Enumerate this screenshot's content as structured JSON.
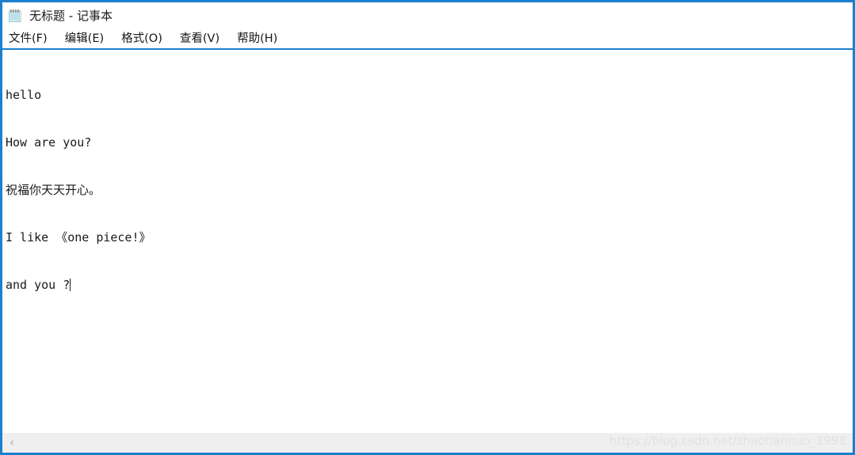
{
  "window": {
    "border_color": "#1b80ce",
    "background": "#ffffff"
  },
  "titlebar": {
    "icon": "notepad-icon",
    "title": "无标题 - 记事本"
  },
  "menubar": {
    "items": [
      {
        "label": "文件(F)"
      },
      {
        "label": "编辑(E)"
      },
      {
        "label": "格式(O)"
      },
      {
        "label": "查看(V)"
      },
      {
        "label": "帮助(H)"
      }
    ]
  },
  "editor": {
    "lines": [
      "hello",
      "How are you?",
      "祝福你天天开心。",
      "I like 《one piece!》",
      "and you ?"
    ],
    "caret_visible": true,
    "text_color": "#1a1a1a"
  },
  "scrollbar": {
    "orientation": "horizontal",
    "left_arrow": "‹",
    "track_color": "#efefef"
  },
  "watermark": {
    "text": "https://blog.csdn.net/zhaotiannuo_1998",
    "color": "#e2e2e2"
  }
}
